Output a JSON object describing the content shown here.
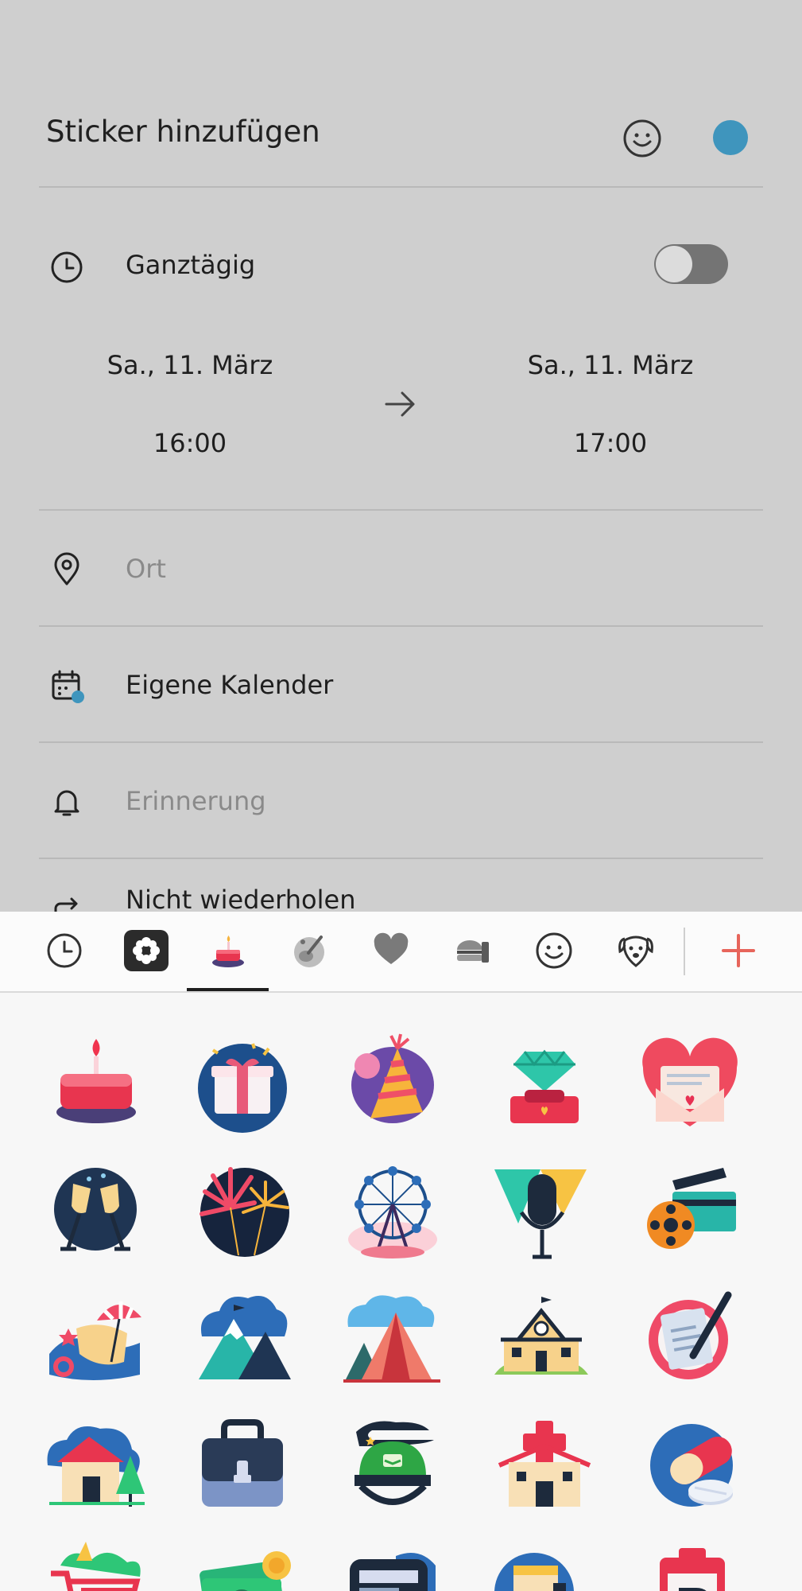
{
  "form": {
    "title": "Sticker hinzufügen",
    "all_day_label": "Ganztägig",
    "all_day_on": false,
    "start": {
      "date": "Sa., 11. März",
      "time": "16:00"
    },
    "end": {
      "date": "Sa., 11. März",
      "time": "17:00"
    },
    "location_placeholder": "Ort",
    "calendar_label": "Eigene Kalender",
    "reminder_placeholder": "Erinnerung",
    "repeat_label": "Nicht wiederholen",
    "accent_color": "#3f95bd"
  },
  "sticker_tabs": [
    {
      "name": "recent-icon"
    },
    {
      "name": "flower-app-icon"
    },
    {
      "name": "birthday-cake-icon",
      "selected": true
    },
    {
      "name": "music-guitar-icon"
    },
    {
      "name": "heart-icon"
    },
    {
      "name": "food-burger-icon"
    },
    {
      "name": "smiley-face-icon"
    },
    {
      "name": "dog-face-icon"
    },
    {
      "name": "add-icon"
    }
  ],
  "stickers": [
    "birthday-cake",
    "gift",
    "party-hat",
    "diamond-ring",
    "love-letter",
    "champagne-toast",
    "fireworks",
    "ferris-wheel",
    "microphone",
    "film-camera",
    "beach",
    "mountains",
    "camping-tent",
    "school",
    "writing-note",
    "house",
    "briefcase",
    "army-helmet",
    "hospital",
    "pills",
    "shopping-cart",
    "money",
    "laptop",
    "alarm-clock",
    "parking-sign"
  ]
}
